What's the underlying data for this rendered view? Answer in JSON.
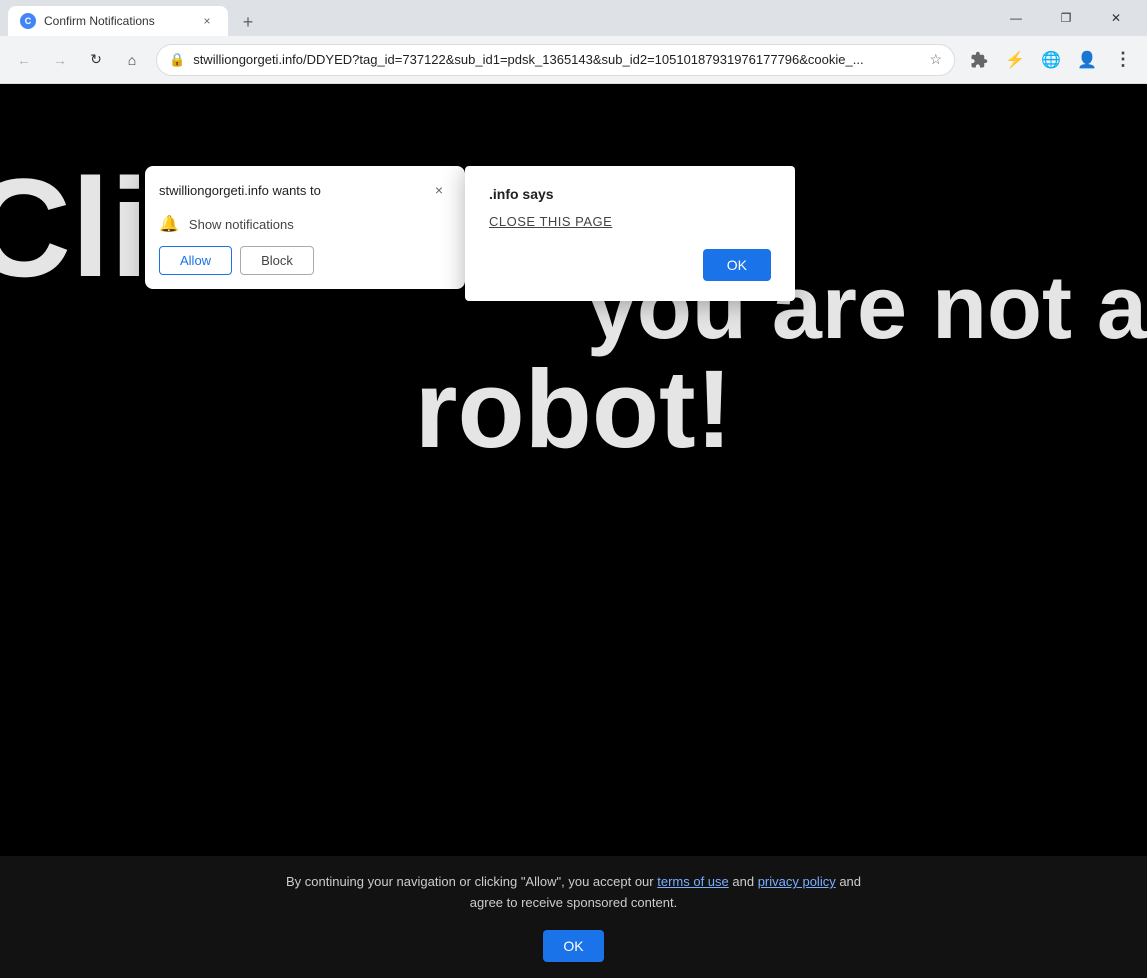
{
  "browser": {
    "tab": {
      "favicon_label": "C",
      "title": "Confirm Notifications",
      "close_label": "×"
    },
    "new_tab_label": "+",
    "window_controls": {
      "minimize": "—",
      "maximize": "❐",
      "close": "✕"
    },
    "nav": {
      "back_label": "←",
      "forward_label": "→",
      "reload_label": "↻",
      "home_label": "⌂",
      "address": "stwilliongorgeti.info/DDYED?tag_id=737122&sub_id1=pdsk_1365143&sub_id2=10510187931976177796&cookie_...",
      "lock_icon": "🔒",
      "star_label": "☆",
      "extensions_label": "◈",
      "performance_label": "⚡",
      "globe_label": "🌐",
      "profile_label": "👤",
      "menu_label": "⋮"
    }
  },
  "page": {
    "bg_text_line1": "Click",
    "bg_text_line2": "you are not a",
    "bg_text_line3": "robot!"
  },
  "notif_dialog": {
    "title": "stwilliongorgeti.info wants to",
    "close_label": "×",
    "permission_text": "Show notifications",
    "allow_label": "Allow",
    "block_label": "Block"
  },
  "site_info_dialog": {
    "title_text": ".info says",
    "link_text": "CLOSE THIS PAGE",
    "ok_label": "OK"
  },
  "bottom_bar": {
    "text_before": "By continuing your navigation or clicking \"Allow\", you accept our ",
    "terms_label": "terms of use",
    "text_and": " and ",
    "privacy_label": "privacy policy",
    "text_after": " and",
    "line2": "agree to receive sponsored content.",
    "ok_label": "OK"
  }
}
